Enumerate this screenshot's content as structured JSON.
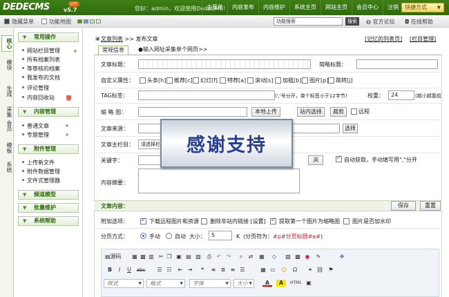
{
  "header": {
    "logo": "DEDECMS",
    "version": "v5.7",
    "badge": "UTF",
    "welcome": "您好：admin，欢迎使用DedeCMS！",
    "nav": [
      "主菜单",
      "内容发布",
      "内容维护",
      "系统主页",
      "网站主页",
      "会员中心",
      "注销"
    ],
    "quick_menu": "快捷方式",
    "quick_arrow": "▼"
  },
  "toolbar": {
    "hide_menu": "隐藏菜单",
    "function_map": "功能地图",
    "search_value": "功能搜索",
    "search_button": "搜索",
    "official_forum": "官方论坛",
    "online_help": "在线帮助"
  },
  "vtabs": [
    "核心",
    "模块",
    "生成",
    "采集",
    "会员",
    "模板",
    "系统"
  ],
  "sidebar": {
    "sections": [
      {
        "title": "常用操作",
        "items": [
          "网站栏目管理",
          "所有档案列表",
          "等审核的档案",
          "我发布的文档",
          "评论管理",
          "内容回收站"
        ]
      },
      {
        "title": "内容管理",
        "items": [
          "普通文章",
          "专题管理"
        ]
      },
      {
        "title": "附件管理",
        "items": [
          "上传新文件",
          "附件数据管理",
          "文件式管理器"
        ]
      },
      {
        "title": "频道模型",
        "items": []
      },
      {
        "title": "批量维护",
        "items": []
      },
      {
        "title": "系统帮助",
        "items": []
      }
    ],
    "chevron": "▼",
    "plus": "+"
  },
  "breadcrumb": {
    "link": "文章列表",
    "sep": ">>",
    "current": "发布文章"
  },
  "links": {
    "saved_list": "[记忆的列表页]",
    "column_manage": "[栏目管理]"
  },
  "tabs": {
    "general": "常规信息",
    "collect": "●输入网址采集单个网页>>"
  },
  "form": {
    "title_label": "文章标题：",
    "short_title_label": "简略标题：",
    "attr_label": "自定义属性：",
    "attrs": [
      "头条[h]",
      "推荐[c]",
      "幻灯[f]",
      "特荐[a]",
      "滚动[s]",
      "加粗[b]",
      "图片[p]",
      "跳转[j]"
    ],
    "tag_label": "TAG标签：",
    "tag_hint": "(','号分开，单个标签小于12字节)",
    "weight_label": "权重：",
    "weight_value": "24",
    "weight_hint": "(越小越靠前)",
    "thumb_label": "缩 略 图：",
    "local_upload": "本地上传",
    "site_select": "站内选择",
    "crop": "裁剪",
    "remote": "远程",
    "source_label": "文章来源：",
    "select_button": "选择",
    "column_label": "文章主栏目：",
    "column_value": "请选择栏目...",
    "keywords_label": "关键字：",
    "keywords_button": "浏览...",
    "auto_get": "自动获取，手动填写用\",\"分开",
    "summary_label": "内容摘要："
  },
  "content": {
    "heading": "文章内容：",
    "save": "保存",
    "reset": "重置",
    "attach_label": "附加选项：",
    "attach_opts": [
      "下载远程图片和资源",
      "删除非站内链接 [设置]",
      "提取第一个图片为缩略图",
      "图片是否加水印"
    ],
    "page_label": "分页方式：",
    "manual": "手动",
    "auto": "自动",
    "size_label": "大小：",
    "size_value": "5",
    "size_unit": "K",
    "page_hint_prefix": "(分页符为：",
    "page_hint_code": "#p#分页标题#e#",
    "page_hint_suffix": ")"
  },
  "editor": {
    "source": "源码",
    "bold": "B",
    "italic": "I",
    "underline": "U",
    "strike": "abc",
    "omega": "Ω",
    "style": "样式",
    "format": "格式",
    "font": "字体",
    "size": "大小",
    "font_color": "A",
    "bg_color": "A",
    "html": "HTML"
  },
  "overlay": {
    "text": "感谢支持"
  },
  "colors": {
    "brand": "#2c6a0c",
    "accent": "#f5d35e",
    "link": "#2b6ad1",
    "highlight": "#d2162a"
  }
}
